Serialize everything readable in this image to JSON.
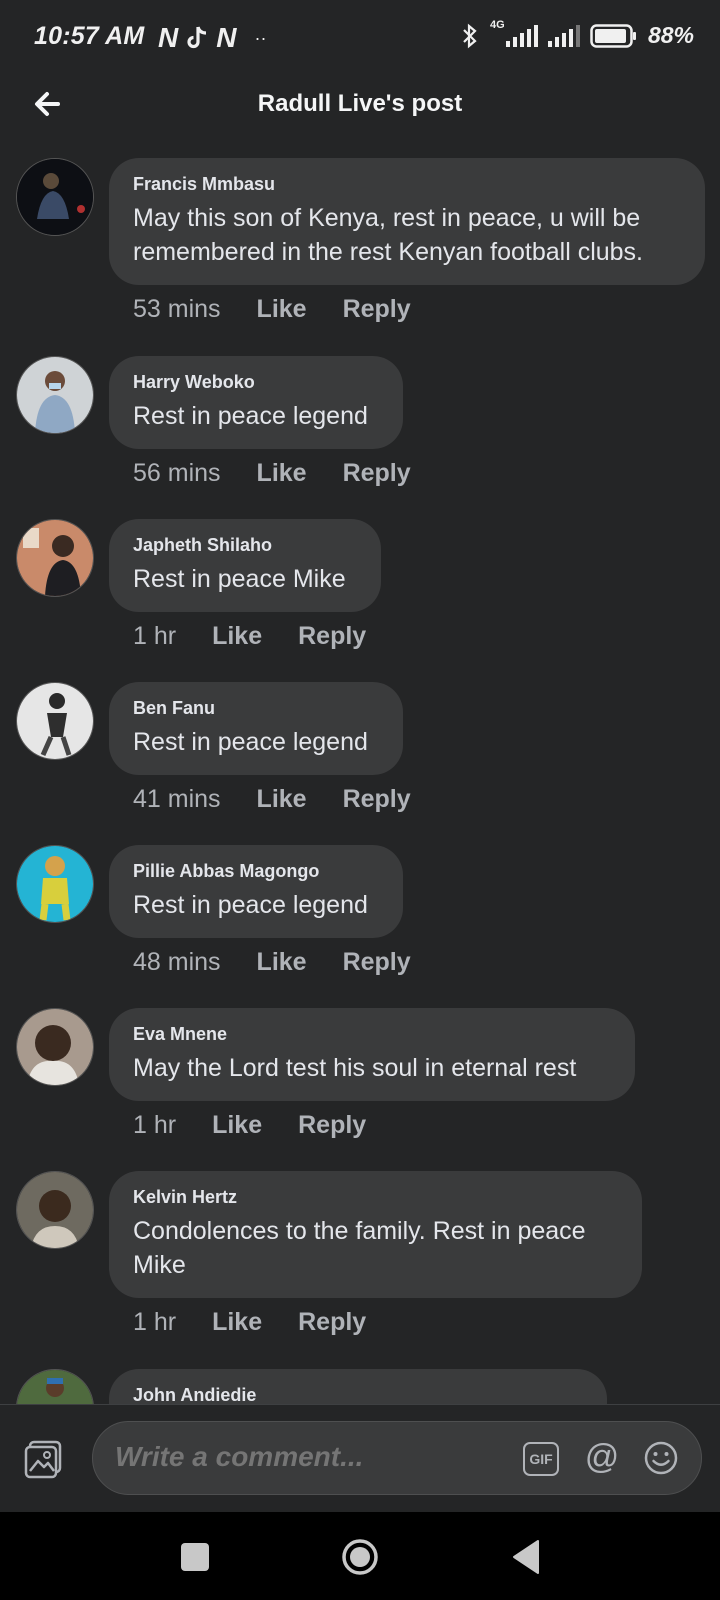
{
  "status_bar": {
    "time": "10:57 AM",
    "left_icons": [
      "netflix-icon",
      "tiktok-icon",
      "netflix-icon"
    ],
    "dots": "··",
    "network": "4G",
    "battery": "88%"
  },
  "header": {
    "title": "Radull Live's post",
    "back_icon": "arrow-left-icon"
  },
  "comments": [
    {
      "name": "Francis Mmbasu",
      "text": "May this son of Kenya, rest in peace, u will be remembered in the rest Kenyan football clubs.",
      "time": "53 mins",
      "like": "Like",
      "reply": "Reply"
    },
    {
      "name": "Harry Weboko",
      "text": "Rest in peace legend",
      "time": "56 mins",
      "like": "Like",
      "reply": "Reply"
    },
    {
      "name": "Japheth Shilaho",
      "text": "Rest in peace Mike",
      "time": "1 hr",
      "like": "Like",
      "reply": "Reply"
    },
    {
      "name": "Ben Fanu",
      "text": "Rest in peace legend",
      "time": "41 mins",
      "like": "Like",
      "reply": "Reply"
    },
    {
      "name": "Pillie Abbas Magongo",
      "text": "Rest in peace legend",
      "time": "48 mins",
      "like": "Like",
      "reply": "Reply"
    },
    {
      "name": "Eva Mnene",
      "text": "May the Lord test his soul in eternal rest",
      "time": "1 hr",
      "like": "Like",
      "reply": "Reply"
    },
    {
      "name": "Kelvin Hertz",
      "text": "Condolences to the family. Rest in peace Mike",
      "time": "1 hr",
      "like": "Like",
      "reply": "Reply"
    },
    {
      "name": "John Andiedie",
      "text": "",
      "time": "",
      "like": "",
      "reply": ""
    }
  ],
  "composer": {
    "placeholder": "Write a comment...",
    "gif_label": "GIF",
    "at_symbol": "@"
  },
  "colors": {
    "background": "#242526",
    "bubble": "#3a3b3c",
    "text": "#e4e6eb",
    "secondary_text": "#b0b3b8"
  }
}
